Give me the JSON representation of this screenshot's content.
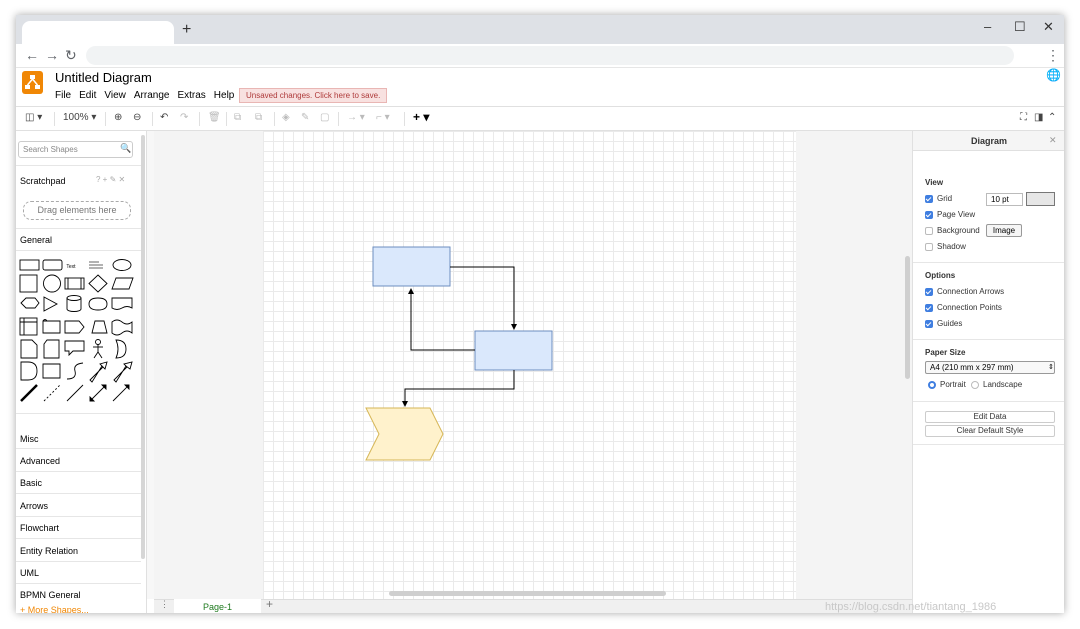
{
  "app": {
    "title": "Untitled Diagram",
    "menu": [
      "File",
      "Edit",
      "View",
      "Arrange",
      "Extras",
      "Help"
    ],
    "unsaved_notice": "Unsaved changes. Click here to save."
  },
  "browser": {
    "new_tab": "+",
    "minimize": "–",
    "maximize": "☐",
    "close": "✕",
    "back": "←",
    "forward": "→",
    "reload": "↻",
    "menu": "⋮"
  },
  "toolbar": {
    "zoom": "100%"
  },
  "sidebar": {
    "search_placeholder": "Search Shapes",
    "scratchpad": "Scratchpad",
    "scratchpad_icons": "? + ✎ ✕",
    "drag_hint": "Drag elements here",
    "general": "General",
    "text_shape": "Text",
    "libraries": [
      "Misc",
      "Advanced",
      "Basic",
      "Arrows",
      "Flowchart",
      "Entity Relation",
      "UML",
      "BPMN General"
    ],
    "more_shapes": "+ More Shapes..."
  },
  "pages": {
    "current": "Page-1",
    "add": "+"
  },
  "format_panel": {
    "title": "Diagram",
    "view_heading": "View",
    "grid_label": "Grid",
    "grid_checked": true,
    "grid_size": "10 pt",
    "page_view_label": "Page View",
    "page_view_checked": true,
    "background_label": "Background",
    "background_checked": false,
    "image_button": "Image",
    "shadow_label": "Shadow",
    "shadow_checked": false,
    "options_heading": "Options",
    "connection_arrows": "Connection Arrows",
    "connection_points": "Connection Points",
    "guides": "Guides",
    "paper_heading": "Paper Size",
    "paper_size": "A4 (210 mm x 297 mm)",
    "portrait": "Portrait",
    "landscape": "Landscape",
    "orientation": "Portrait",
    "edit_data": "Edit Data",
    "clear_style": "Clear Default Style"
  },
  "watermark": "https://blog.csdn.net/tiantang_1986",
  "colors": {
    "accent": "#f08705",
    "box_fill": "#dae8fc",
    "box_stroke": "#6c8ebf",
    "step_fill": "#fff2cc",
    "step_stroke": "#d6b656",
    "checkbox": "#3f7ee0"
  }
}
